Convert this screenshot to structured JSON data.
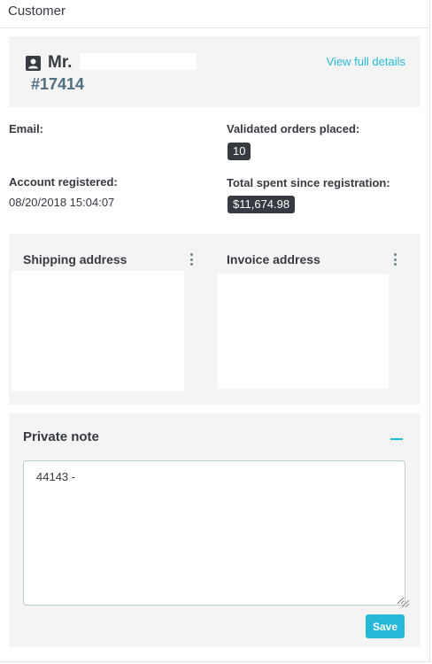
{
  "header": {
    "title": "Customer"
  },
  "customer": {
    "name": "Mr.",
    "id": "#17414",
    "view_details_label": "View full details"
  },
  "info": {
    "email_label": "Email:",
    "validated_orders_label": "Validated orders placed:",
    "validated_orders_value": "10",
    "account_registered_label": "Account registered:",
    "account_registered_value": "08/20/2018 15:04:07",
    "total_spent_label": "Total spent since registration:",
    "total_spent_value": "$11,674.98"
  },
  "addresses": {
    "shipping_label": "Shipping address",
    "invoice_label": "Invoice address"
  },
  "private_note": {
    "title": "Private note",
    "text": "44143 -",
    "save_label": "Save"
  },
  "colors": {
    "accent": "#25b9d7",
    "id_color": "#4f6e82",
    "badge_bg": "#363a41",
    "panel_bg": "#f4f4f5"
  },
  "icons": [
    "person-icon",
    "kebab-menu-icon",
    "collapse-icon",
    "resize-grip-icon"
  ]
}
